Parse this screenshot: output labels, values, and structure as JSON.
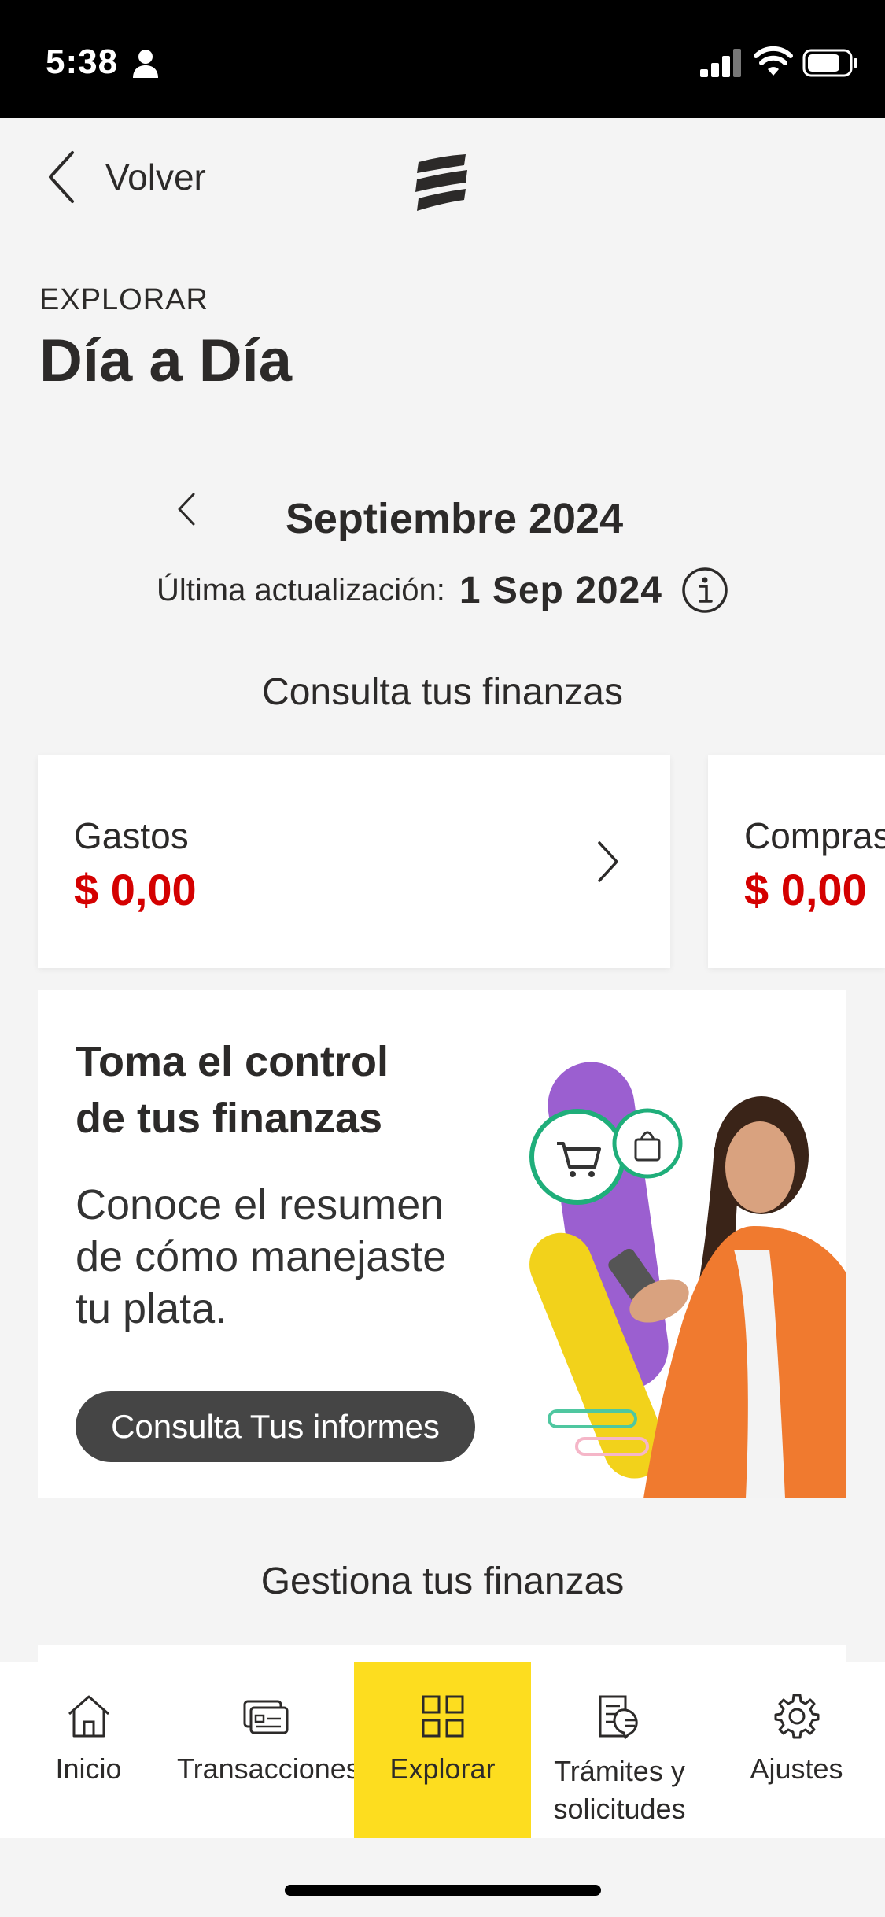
{
  "status_bar": {
    "time": "5:38"
  },
  "header": {
    "back_label": "Volver",
    "section": "EXPLORAR",
    "title": "Día a Día"
  },
  "period": {
    "month": "Septiembre 2024",
    "update_label": "Última actualización:",
    "update_date": "1 Sep 2024"
  },
  "consulta_heading": "Consulta tus finanzas",
  "cards": [
    {
      "title": "Gastos",
      "amount": "$ 0,00"
    },
    {
      "title": "Compras",
      "amount": "$ 0,00"
    }
  ],
  "promo": {
    "title_line1": "Toma el control",
    "title_line2": "de tus finanzas",
    "text_line1": "Conoce el resumen",
    "text_line2": "de cómo manejaste",
    "text_line3": "tu plata.",
    "button_label": "Consulta Tus informes"
  },
  "gestiona_heading": "Gestiona tus finanzas",
  "tabs": [
    {
      "label": "Inicio",
      "icon": "home-icon"
    },
    {
      "label": "Transacciones",
      "icon": "card-icon"
    },
    {
      "label": "Explorar",
      "icon": "grid-icon"
    },
    {
      "label_line1": "Trámites y",
      "label_line2": "solicitudes",
      "icon": "document-icon"
    },
    {
      "label": "Ajustes",
      "icon": "gear-icon"
    }
  ],
  "colors": {
    "accent": "#fddd1f",
    "amount": "#d40000",
    "dark_button": "#454545"
  }
}
